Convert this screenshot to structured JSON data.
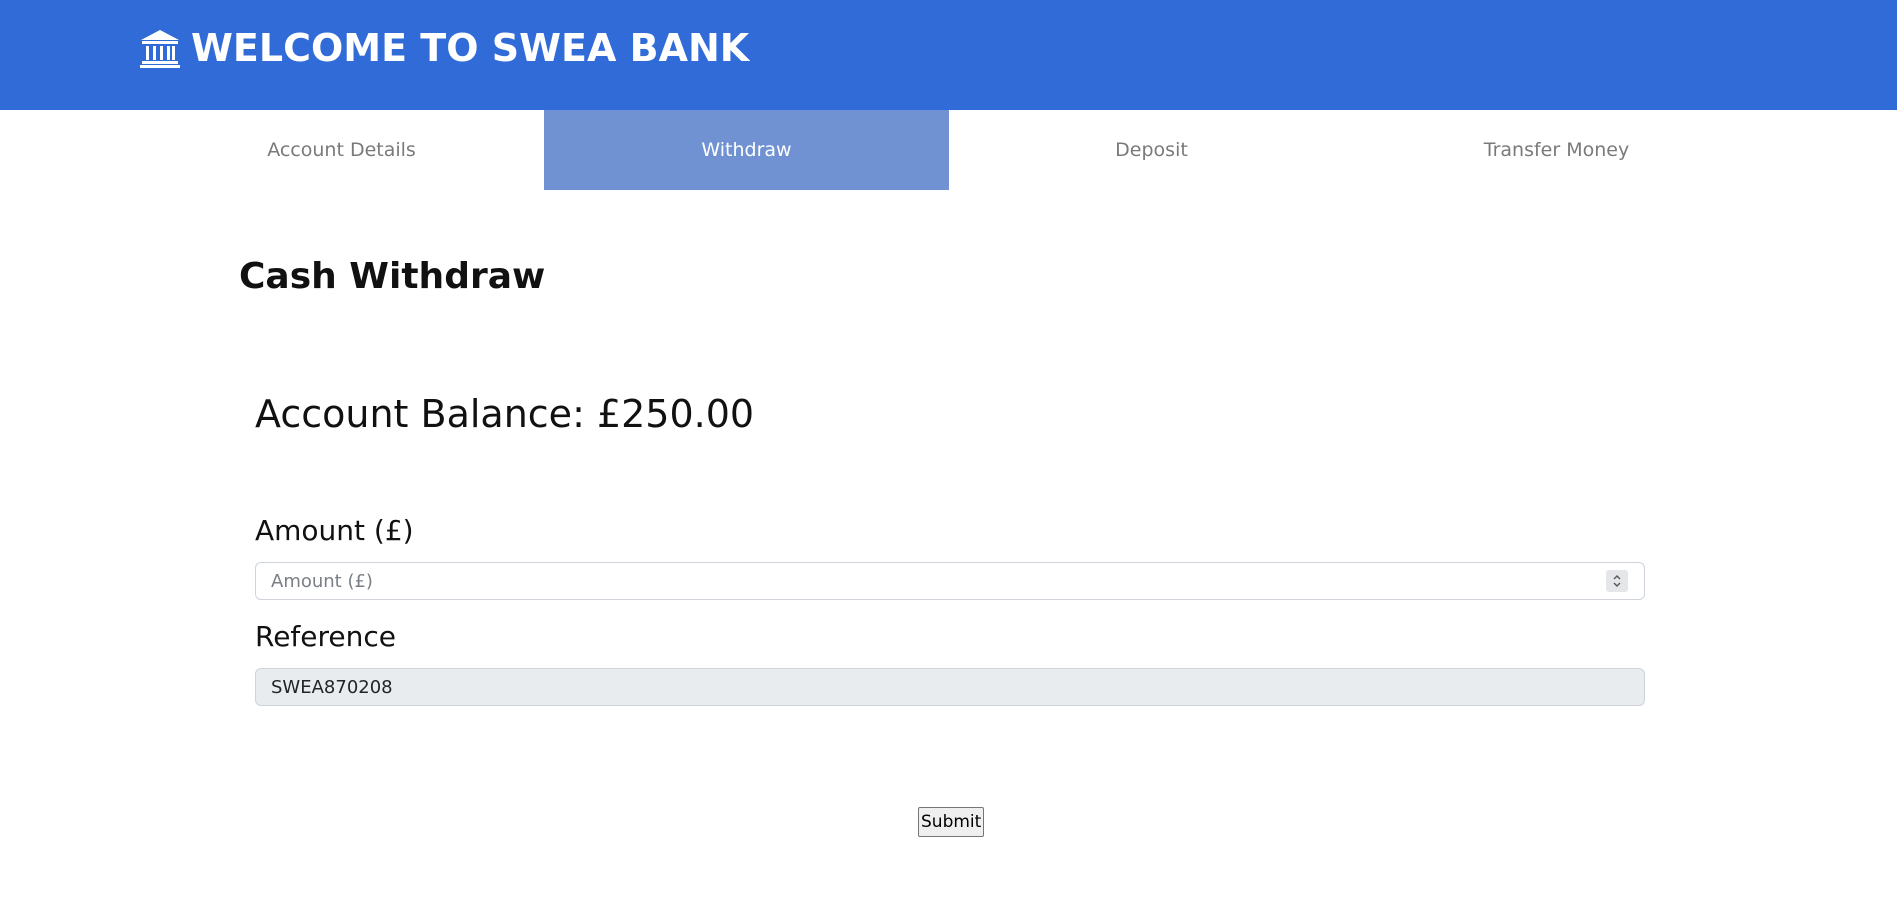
{
  "header": {
    "icon": "bank-icon",
    "title": "WELCOME TO SWEA BANK",
    "background": "#316bd8"
  },
  "tabs": [
    {
      "label": "Account Details",
      "active": false
    },
    {
      "label": "Withdraw",
      "active": true
    },
    {
      "label": "Deposit",
      "active": false
    },
    {
      "label": "Transfer Money",
      "active": false
    }
  ],
  "page": {
    "title": "Cash Withdraw",
    "balance_text": "Account Balance: £250.00"
  },
  "form": {
    "amount": {
      "label": "Amount (£)",
      "placeholder": "Amount (£)",
      "value": ""
    },
    "reference": {
      "label": "Reference",
      "value": "SWEA870208"
    },
    "submit_label": "Submit"
  },
  "colors": {
    "accent": "#316bd8",
    "active_tab": "#7092d2"
  }
}
